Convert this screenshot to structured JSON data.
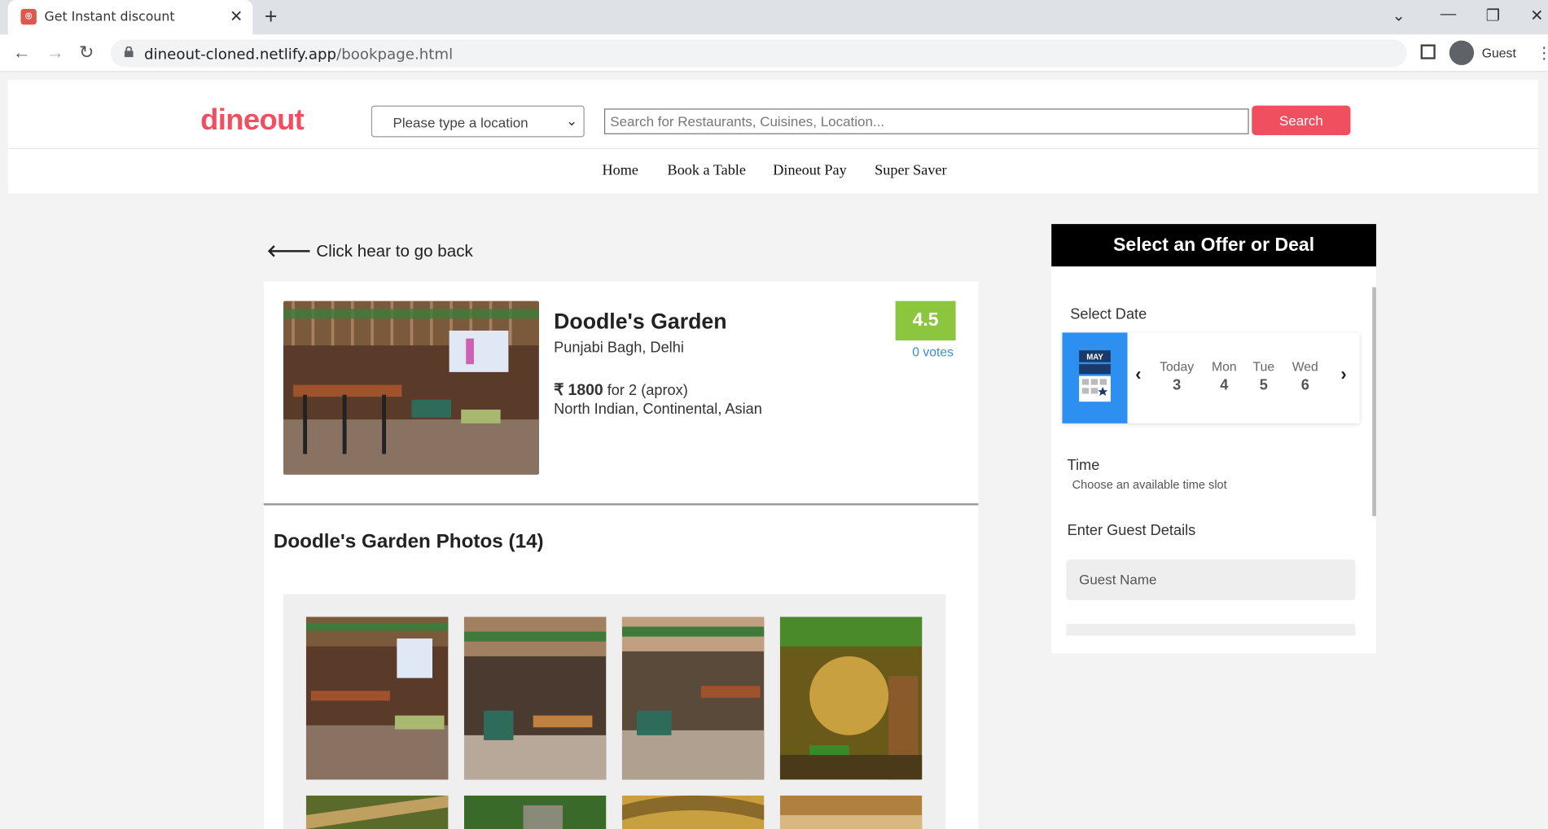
{
  "browser": {
    "tab_title": "Get Instant discount",
    "url_host": "dineout-cloned.netlify.app",
    "url_path": "/bookpage.html",
    "profile_name": "Guest"
  },
  "header": {
    "logo": "dineout",
    "location_placeholder": "Please type a location",
    "search_placeholder": "Search for Restaurants, Cuisines, Location...",
    "search_button": "Search",
    "nav": [
      "Home",
      "Book a Table",
      "Dineout Pay",
      "Super Saver"
    ]
  },
  "back_link": "Click hear to go back",
  "restaurant": {
    "name": "Doodle's Garden",
    "location": "Punjabi Bagh, Delhi",
    "currency": "₹",
    "price": "1800",
    "price_suffix": "for 2 (aprox)",
    "cuisines": "North Indian, Continental, Asian",
    "rating": "4.5",
    "votes": "0 votes",
    "photos_title": "Doodle's Garden Photos (14)"
  },
  "offer_panel": {
    "title": "Select an Offer or Deal",
    "select_date_label": "Select Date",
    "calendar_month": "MAY",
    "dates": [
      {
        "day": "Today",
        "num": "3"
      },
      {
        "day": "Mon",
        "num": "4"
      },
      {
        "day": "Tue",
        "num": "5"
      },
      {
        "day": "Wed",
        "num": "6"
      }
    ],
    "time_label": "Time",
    "time_sub": "Choose an available time slot",
    "guest_label": "Enter Guest Details",
    "guest_name_placeholder": "Guest Name"
  },
  "colors": {
    "brand": "#ef4f5f",
    "rating_bg": "#8cc63f",
    "calendar_blue": "#2d8ff0",
    "votes_link": "#3a8bd8"
  }
}
